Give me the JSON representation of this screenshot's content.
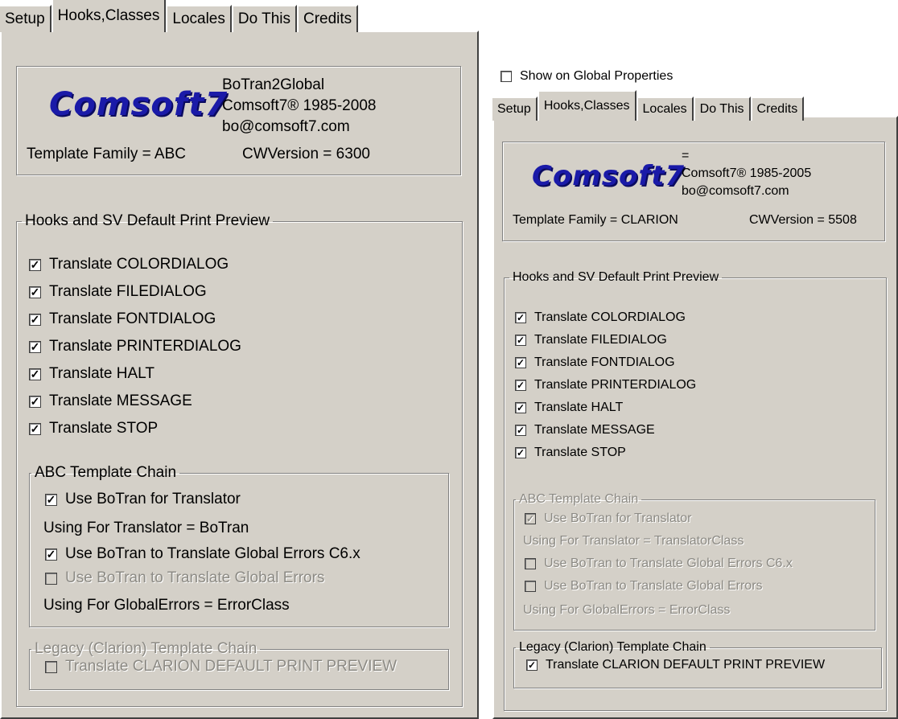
{
  "left": {
    "tabs": [
      "Setup",
      "Hooks,Classes",
      "Locales",
      "Do This",
      "Credits"
    ],
    "active_tab": "Hooks,Classes",
    "logo_text": "Comsoft7",
    "info_lines": [
      "BoTran2Global",
      "Comsoft7® 1985-2008",
      "bo@comsoft7.com"
    ],
    "template_family": "Template Family = ABC",
    "cw_version": "CWVersion = 6300",
    "hooks_group_title": "Hooks and SV Default Print Preview",
    "hooks": [
      {
        "label": "Translate COLORDIALOG",
        "checked": true
      },
      {
        "label": "Translate FILEDIALOG",
        "checked": true
      },
      {
        "label": "Translate FONTDIALOG",
        "checked": true
      },
      {
        "label": "Translate PRINTERDIALOG",
        "checked": true
      },
      {
        "label": "Translate HALT",
        "checked": true
      },
      {
        "label": "Translate MESSAGE",
        "checked": true
      },
      {
        "label": "Translate STOP",
        "checked": true
      }
    ],
    "abc_group_title": "ABC Template Chain",
    "abc_use_botran": "Use BoTran for Translator",
    "abc_using_translator": "Using For Translator =  BoTran",
    "abc_global_errors_c6": "Use BoTran to Translate Global Errors C6.x",
    "abc_global_errors": "Use BoTran to Translate Global Errors",
    "abc_using_globalerrors": "Using For GlobalErrors =  ErrorClass",
    "legacy_group_title": "Legacy (Clarion) Template Chain",
    "legacy_print_preview": "Translate CLARION DEFAULT PRINT PREVIEW"
  },
  "right": {
    "show_on_global": "Show on Global Properties",
    "tabs": [
      "Setup",
      "Hooks,Classes",
      "Locales",
      "Do This",
      "Credits"
    ],
    "active_tab": "Hooks,Classes",
    "logo_text": "Comsoft7",
    "info_lines": [
      "=",
      "Comsoft7® 1985-2005",
      "bo@comsoft7.com"
    ],
    "template_family": "Template Family = CLARION",
    "cw_version": "CWVersion = 5508",
    "hooks_group_title": "Hooks and SV Default Print Preview",
    "hooks": [
      {
        "label": "Translate COLORDIALOG",
        "checked": true
      },
      {
        "label": "Translate FILEDIALOG",
        "checked": true
      },
      {
        "label": "Translate FONTDIALOG",
        "checked": true
      },
      {
        "label": "Translate PRINTERDIALOG",
        "checked": true
      },
      {
        "label": "Translate HALT",
        "checked": true
      },
      {
        "label": "Translate MESSAGE",
        "checked": true
      },
      {
        "label": "Translate STOP",
        "checked": true
      }
    ],
    "abc_group_title": "ABC Template Chain",
    "abc_use_botran": "Use BoTran for Translator",
    "abc_using_translator": "Using For Translator =  TranslatorClass",
    "abc_global_errors_c6": "Use BoTran to Translate Global Errors C6.x",
    "abc_global_errors": "Use BoTran to Translate Global Errors",
    "abc_using_globalerrors": "Using For GlobalErrors =  ErrorClass",
    "legacy_group_title": "Legacy (Clarion) Template Chain",
    "legacy_print_preview": "Translate CLARION DEFAULT PRINT PREVIEW"
  },
  "colors": {
    "panel_bg": "#d4d0c8",
    "logo_blue": "#1a1aa8",
    "disabled_text": "#8c8a84"
  }
}
